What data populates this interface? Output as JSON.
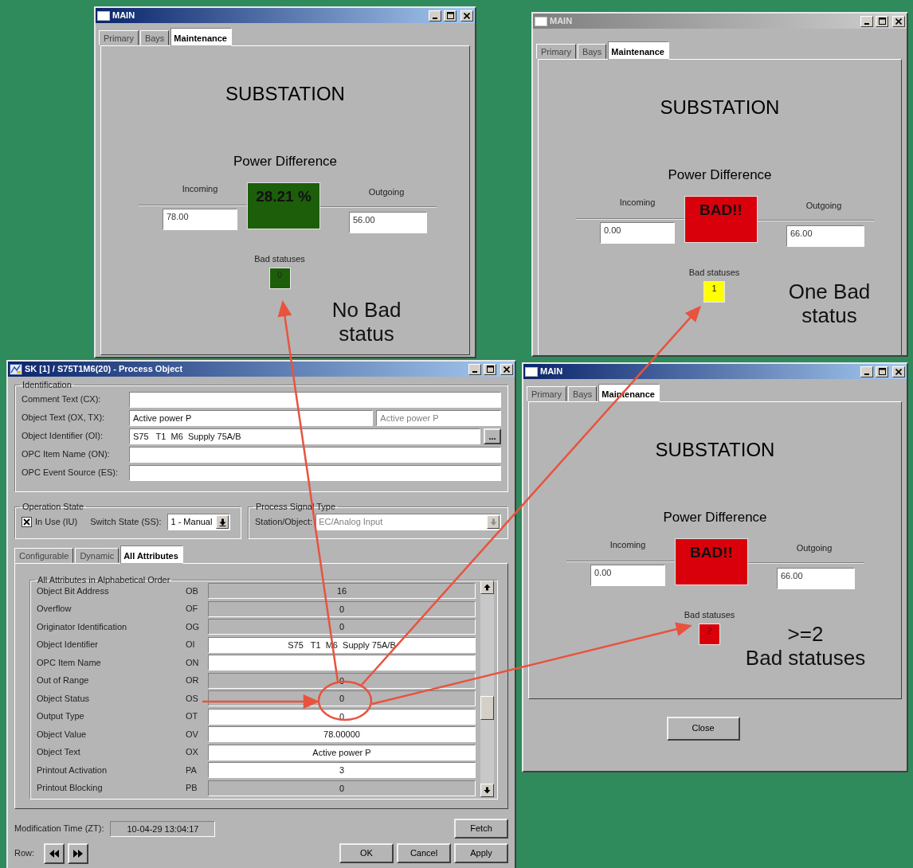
{
  "dashboards": [
    {
      "title": "MAIN",
      "active": true,
      "tabs": [
        {
          "label": "Primary",
          "selected": false
        },
        {
          "label": "Bays",
          "selected": false
        },
        {
          "label": "Maintenance",
          "selected": true
        }
      ],
      "heading": "SUBSTATION",
      "subheading": "Power Difference",
      "incoming": {
        "label": "Incoming",
        "value": "78.00"
      },
      "outgoing": {
        "label": "Outgoing",
        "value": "56.00"
      },
      "difference": {
        "text": "28.21 %",
        "color": "#1d5e0b"
      },
      "bad_statuses": {
        "label": "Bad statuses",
        "value": "0",
        "color": "#1d5e0b"
      },
      "annotation": "No Bad\nstatus"
    },
    {
      "title": "MAIN",
      "active": false,
      "tabs": [
        {
          "label": "Primary",
          "selected": false
        },
        {
          "label": "Bays",
          "selected": false
        },
        {
          "label": "Maintenance",
          "selected": true
        }
      ],
      "heading": "SUBSTATION",
      "subheading": "Power Difference",
      "incoming": {
        "label": "Incoming",
        "value": "0.00"
      },
      "outgoing": {
        "label": "Outgoing",
        "value": "66.00"
      },
      "difference": {
        "text": "BAD!!",
        "color": "#d9000b"
      },
      "bad_statuses": {
        "label": "Bad statuses",
        "value": "1",
        "color": "#ffff00"
      },
      "annotation": "One Bad\nstatus"
    },
    {
      "title": "MAIN",
      "active": true,
      "tabs": [
        {
          "label": "Primary",
          "selected": false
        },
        {
          "label": "Bays",
          "selected": false
        },
        {
          "label": "Maintenance",
          "selected": true
        }
      ],
      "heading": "SUBSTATION",
      "subheading": "Power Difference",
      "incoming": {
        "label": "Incoming",
        "value": "0.00"
      },
      "outgoing": {
        "label": "Outgoing",
        "value": "66.00"
      },
      "difference": {
        "text": "BAD!!",
        "color": "#d9000b"
      },
      "bad_statuses": {
        "label": "Bad statuses",
        "value": "2",
        "color": "#d9000b"
      },
      "annotation": ">=2\nBad statuses",
      "button": "Close"
    }
  ],
  "process_object": {
    "title": "SK [1] / S75T1M6(20) - Process Object",
    "active": true,
    "identification": {
      "legend": "Identification",
      "rows": [
        {
          "label": "Comment Text (CX):",
          "kind": "field"
        },
        {
          "label": "Object Text (OX, TX):",
          "kind": "pair",
          "value": "Active power P",
          "secondary": "Active power P"
        },
        {
          "label": "Object Identifier (OI):",
          "kind": "browse",
          "value": "S75   T1  M6  Supply 75A/B",
          "button": "..."
        },
        {
          "label": "OPC Item Name (ON):",
          "kind": "field"
        },
        {
          "label": "OPC Event Source (ES):",
          "kind": "field"
        }
      ]
    },
    "operation_state": {
      "legend": "Operation State",
      "in_use": {
        "label": "In Use (IU)",
        "checked": true
      },
      "switch_state": {
        "label": "Switch State (SS):",
        "value": "1 - Manual"
      }
    },
    "signal_type": {
      "legend": "Process Signal Type",
      "label": "Station/Object:",
      "value": "EC/Analog Input",
      "disabled": true
    },
    "tabs": [
      {
        "label": "Configurable",
        "selected": false
      },
      {
        "label": "Dynamic",
        "selected": false
      },
      {
        "label": "All Attributes",
        "selected": true
      }
    ],
    "attributes": {
      "legend": "All Attributes in Alphabetical Order",
      "rows": [
        {
          "name": "Object Bit Address",
          "code": "OB",
          "value": "16",
          "editable": false
        },
        {
          "name": "Overflow",
          "code": "OF",
          "value": "0",
          "editable": false
        },
        {
          "name": "Originator Identification",
          "code": "OG",
          "value": "0",
          "editable": false
        },
        {
          "name": "Object Identifier",
          "code": "OI",
          "value": "S75   T1  M6  Supply 75A/B",
          "editable": true
        },
        {
          "name": "OPC Item Name",
          "code": "ON",
          "editable": true
        },
        {
          "name": "Out of Range",
          "code": "OR",
          "value": "0",
          "editable": false
        },
        {
          "name": "Object Status",
          "code": "OS",
          "value": "0",
          "editable": false
        },
        {
          "name": "Output Type",
          "code": "OT",
          "value": "0",
          "editable": true
        },
        {
          "name": "Object Value",
          "code": "OV",
          "value": "78.00000",
          "editable": true
        },
        {
          "name": "Object Text",
          "code": "OX",
          "value": "Active power P",
          "editable": true
        },
        {
          "name": "Printout Activation",
          "code": "PA",
          "value": "3",
          "editable": true
        },
        {
          "name": "Printout Blocking",
          "code": "PB",
          "value": "0",
          "editable": false
        }
      ]
    },
    "modification_time": {
      "label": "Modification Time (ZT):",
      "value": "10-04-29 13:04:17"
    },
    "row_label": "Row:",
    "buttons": [
      "Fetch",
      "OK",
      "Cancel",
      "Apply"
    ]
  }
}
